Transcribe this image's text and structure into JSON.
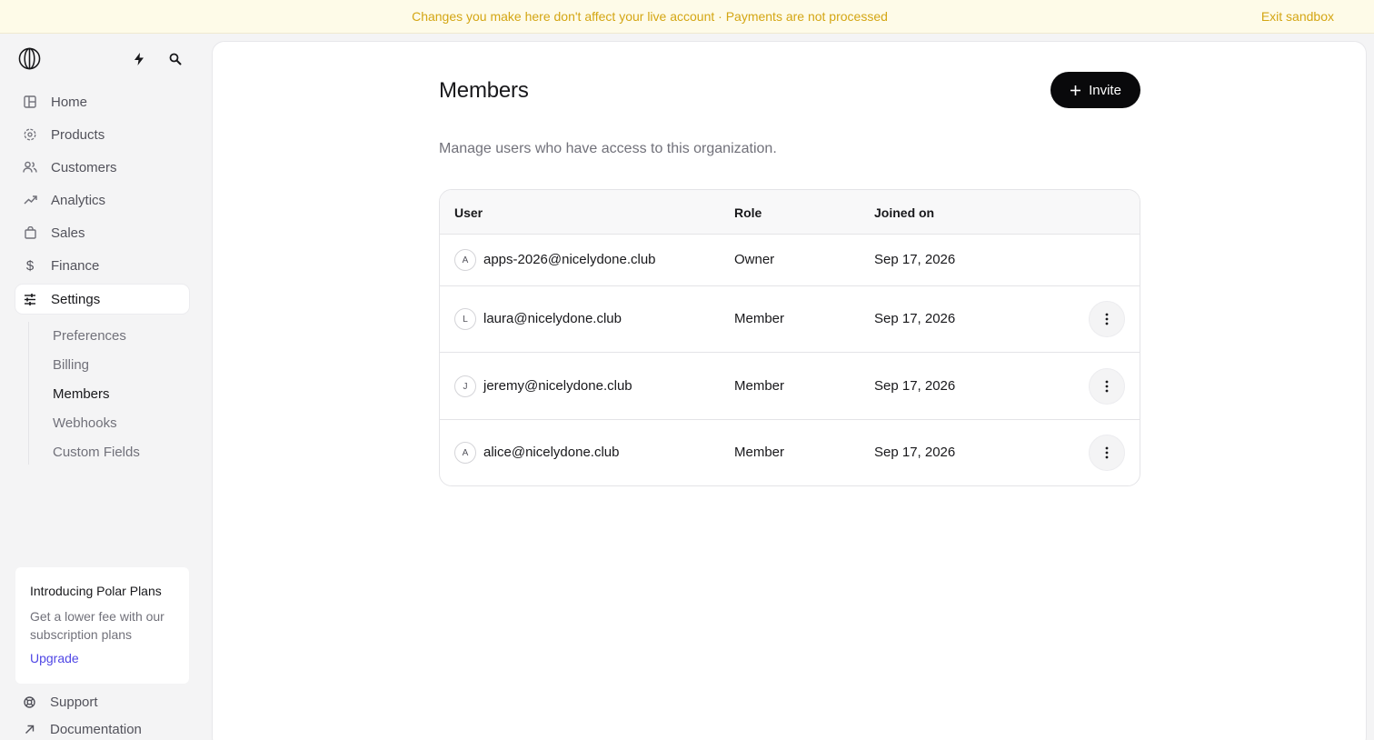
{
  "banner": {
    "message": "Changes you make here don't affect your live account · Payments are not processed",
    "exit_label": "Exit sandbox"
  },
  "sidebar": {
    "top_icons": [
      "polar-logo-icon",
      "lightning-icon",
      "search-icon"
    ],
    "nav": [
      {
        "label": "Home",
        "icon": "home-icon"
      },
      {
        "label": "Products",
        "icon": "products-icon"
      },
      {
        "label": "Customers",
        "icon": "customers-icon"
      },
      {
        "label": "Analytics",
        "icon": "analytics-icon"
      },
      {
        "label": "Sales",
        "icon": "sales-bag-icon"
      },
      {
        "label": "Finance",
        "icon": "dollar-icon"
      },
      {
        "label": "Settings",
        "icon": "sliders-icon",
        "active": true
      }
    ],
    "subnav": [
      {
        "label": "Preferences"
      },
      {
        "label": "Billing"
      },
      {
        "label": "Members",
        "active": true
      },
      {
        "label": "Webhooks"
      },
      {
        "label": "Custom Fields"
      }
    ],
    "promo": {
      "title": "Introducing Polar Plans",
      "body": "Get a lower fee with our subscription plans",
      "link": "Upgrade"
    },
    "footer": [
      {
        "label": "Support",
        "icon": "lifebuoy-icon"
      },
      {
        "label": "Documentation",
        "icon": "external-arrow-icon"
      }
    ]
  },
  "main": {
    "title": "Members",
    "invite_label": "Invite",
    "subtitle": "Manage users who have access to this organization.",
    "table": {
      "columns": [
        "User",
        "Role",
        "Joined on"
      ],
      "rows": [
        {
          "initial": "A",
          "email": "apps-2026@nicelydone.club",
          "role": "Owner",
          "joined": "Sep 17, 2026",
          "has_menu": false
        },
        {
          "initial": "L",
          "email": "laura@nicelydone.club",
          "role": "Member",
          "joined": "Sep 17, 2026",
          "has_menu": true
        },
        {
          "initial": "J",
          "email": "jeremy@nicelydone.club",
          "role": "Member",
          "joined": "Sep 17, 2026",
          "has_menu": true
        },
        {
          "initial": "A",
          "email": "alice@nicelydone.club",
          "role": "Member",
          "joined": "Sep 17, 2026",
          "has_menu": true
        }
      ]
    }
  },
  "colors": {
    "banner_bg": "#fefbe8",
    "banner_text": "#d4a614",
    "accent_link": "#4f46e5",
    "primary_button": "#09090b"
  }
}
